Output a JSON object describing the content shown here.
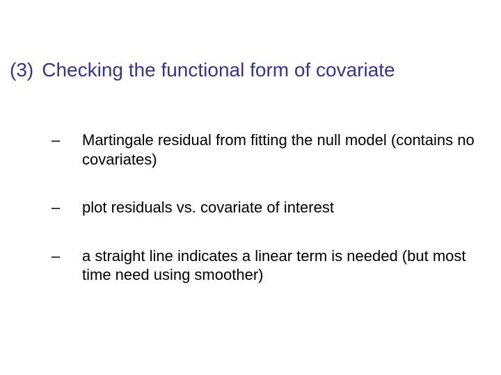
{
  "title": {
    "number": "(3)",
    "text": "Checking the functional form of covariate"
  },
  "bullets": [
    {
      "dash": "–",
      "text": "Martingale residual from fitting the null model (contains no covariates)"
    },
    {
      "dash": "–",
      "text": "plot residuals vs. covariate of interest"
    },
    {
      "dash": "–",
      "text": "a straight line indicates a linear term is needed (but most time need using smoother)"
    }
  ]
}
